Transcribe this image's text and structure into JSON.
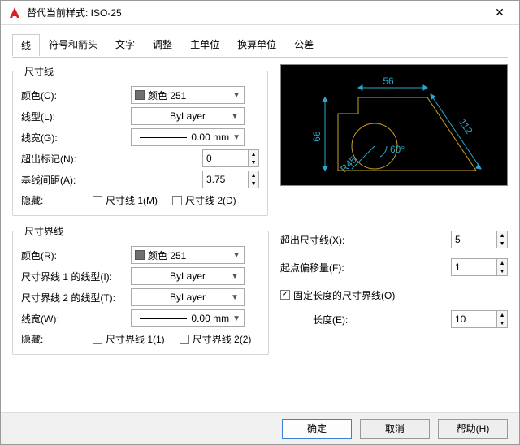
{
  "titlebar": {
    "title": "替代当前样式: ISO-25",
    "close": "✕"
  },
  "tabs": [
    "线",
    "符号和箭头",
    "文字",
    "调整",
    "主单位",
    "换算单位",
    "公差"
  ],
  "dimline": {
    "legend": "尺寸线",
    "color": {
      "label": "颜色(C):",
      "text": "颜色 251"
    },
    "ltype": {
      "label": "线型(L):",
      "text": "ByLayer"
    },
    "lweight": {
      "label": "线宽(G):",
      "text": "0.00 mm"
    },
    "ext": {
      "label": "超出标记(N):",
      "value": "0"
    },
    "baseline": {
      "label": "基线间距(A):",
      "value": "3.75"
    },
    "hide": {
      "label": "隐藏:",
      "c1": "尺寸线 1(M)",
      "c2": "尺寸线 2(D)"
    }
  },
  "extline": {
    "legend": "尺寸界线",
    "color": {
      "label": "颜色(R):",
      "text": "颜色 251"
    },
    "lt1": {
      "label": "尺寸界线 1 的线型(I):",
      "text": "ByLayer"
    },
    "lt2": {
      "label": "尺寸界线 2 的线型(T):",
      "text": "ByLayer"
    },
    "lweight": {
      "label": "线宽(W):",
      "text": "0.00 mm"
    },
    "hide": {
      "label": "隐藏:",
      "c1": "尺寸界线 1(1)",
      "c2": "尺寸界线 2(2)"
    }
  },
  "right": {
    "beyond": {
      "label": "超出尺寸线(X):",
      "value": "5"
    },
    "offset": {
      "label": "起点偏移量(F):",
      "value": "1"
    },
    "fixed": {
      "label": "固定长度的尺寸界线(O)"
    },
    "length": {
      "label": "长度(E):",
      "value": "10"
    }
  },
  "preview": {
    "d56": "56",
    "d66": "66",
    "d112": "112",
    "r45": "R45",
    "a60": "60°"
  },
  "buttons": {
    "ok": "确定",
    "cancel": "取消",
    "help": "帮助(H)"
  }
}
